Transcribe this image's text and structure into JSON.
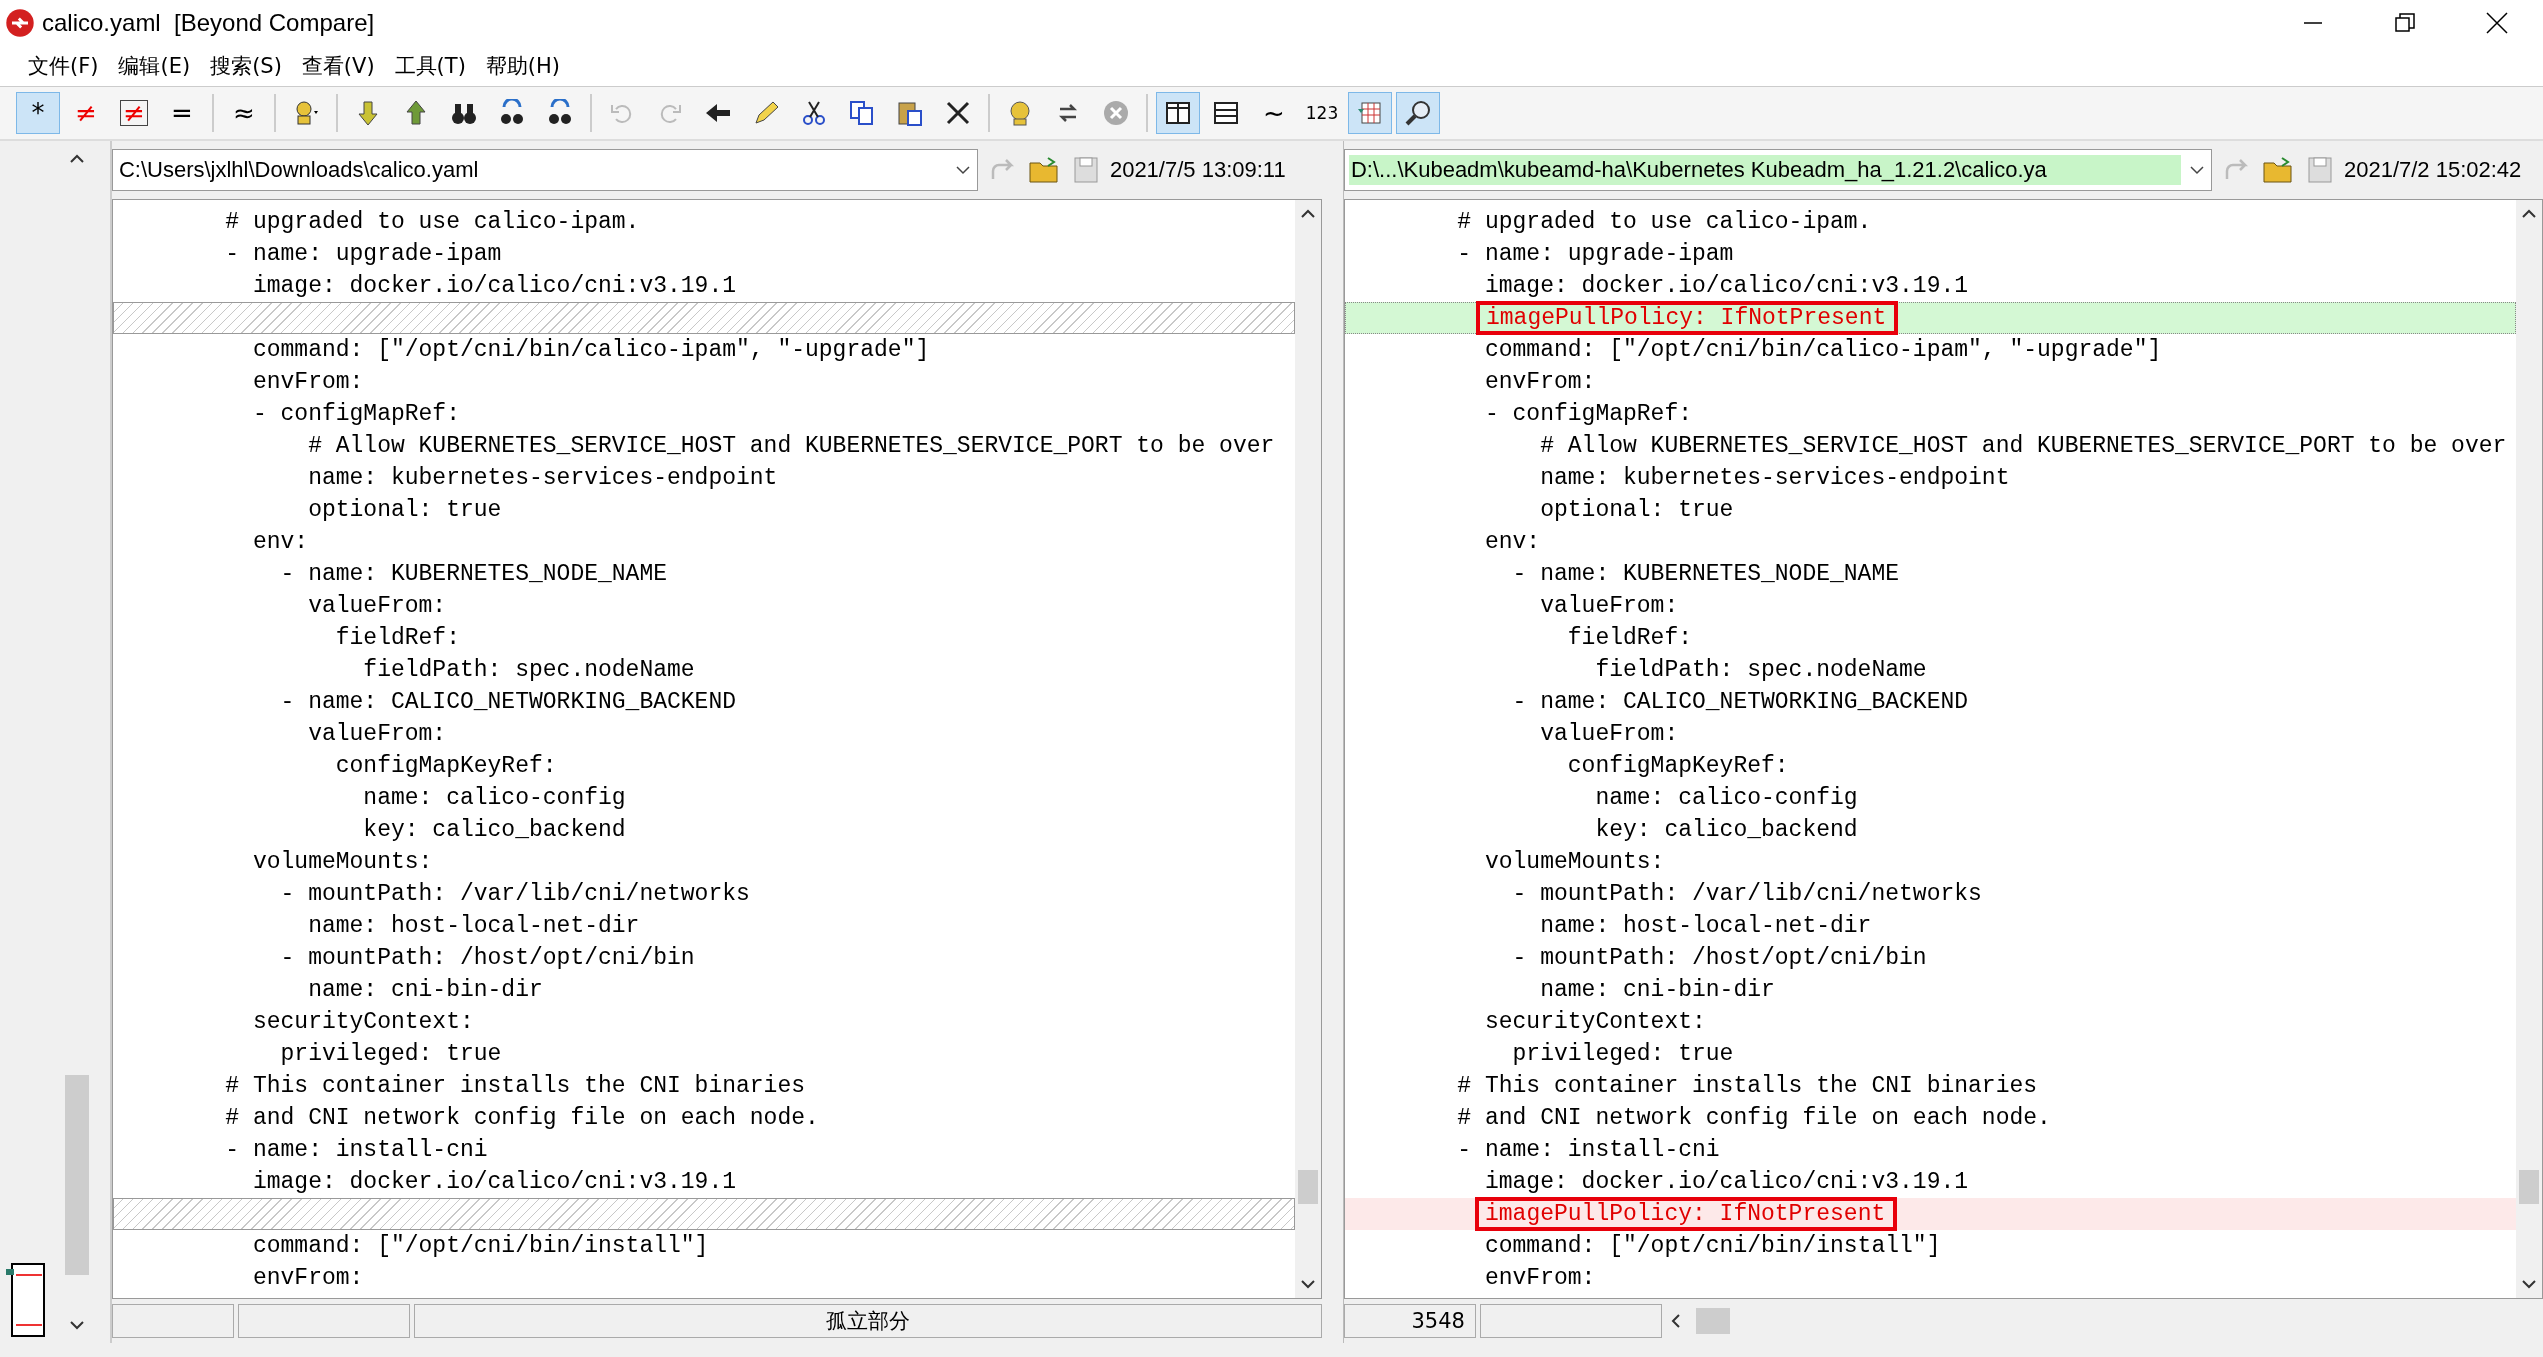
{
  "window": {
    "title": "calico.yaml  [Beyond Compare]"
  },
  "menu": [
    "文件(F)",
    "编辑(E)",
    "搜索(S)",
    "查看(V)",
    "工具(T)",
    "帮助(H)"
  ],
  "toolbar": [
    {
      "kind": "text",
      "label": "*",
      "selected": true
    },
    {
      "kind": "text",
      "label": "≠",
      "selected": false
    },
    {
      "kind": "boxed",
      "label": "≠",
      "selected": false
    },
    {
      "kind": "text",
      "label": "=",
      "selected": false
    },
    {
      "kind": "sep"
    },
    {
      "kind": "text",
      "label": "≈",
      "selected": false
    },
    {
      "kind": "sep"
    },
    {
      "kind": "icon",
      "selected": false
    },
    {
      "kind": "sep"
    },
    {
      "kind": "icon",
      "selected": false
    },
    {
      "kind": "icon",
      "selected": false
    },
    {
      "kind": "icon",
      "selected": false
    },
    {
      "kind": "icon",
      "selected": false
    },
    {
      "kind": "icon",
      "selected": false
    },
    {
      "kind": "sep"
    },
    {
      "kind": "icon",
      "selected": false
    },
    {
      "kind": "icon",
      "selected": false
    },
    {
      "kind": "icon",
      "selected": false
    },
    {
      "kind": "icon",
      "selected": false
    },
    {
      "kind": "icon",
      "selected": false
    },
    {
      "kind": "icon",
      "selected": false
    },
    {
      "kind": "icon",
      "selected": false
    },
    {
      "kind": "icon",
      "selected": false
    },
    {
      "kind": "sep"
    },
    {
      "kind": "icon",
      "selected": false
    },
    {
      "kind": "icon",
      "selected": false
    },
    {
      "kind": "icon",
      "selected": false
    },
    {
      "kind": "sep"
    },
    {
      "kind": "icon",
      "selected": true
    },
    {
      "kind": "icon",
      "selected": false
    },
    {
      "kind": "text",
      "label": "~",
      "selected": false
    },
    {
      "kind": "small",
      "label": "123",
      "selected": false
    },
    {
      "kind": "icon",
      "selected": true
    },
    {
      "kind": "icon",
      "selected": true
    }
  ],
  "panes": [
    {
      "path": "C:\\Users\\jxlhl\\Downloads\\calico.yaml",
      "path_differs": false,
      "date": "2021/7/5 13:09:11",
      "lines": [
        {
          "kind": "plain",
          "text": "        # upgraded to use calico-ipam."
        },
        {
          "kind": "plain",
          "text": "        - name: upgrade-ipam"
        },
        {
          "kind": "plain",
          "text": "          image: docker.io/calico/cni:v3.19.1"
        },
        {
          "kind": "gap"
        },
        {
          "kind": "plain",
          "text": "          command: [\"/opt/cni/bin/calico-ipam\", \"-upgrade\"]"
        },
        {
          "kind": "plain",
          "text": "          envFrom:"
        },
        {
          "kind": "plain",
          "text": "          - configMapRef:"
        },
        {
          "kind": "plain",
          "text": "              # Allow KUBERNETES_SERVICE_HOST and KUBERNETES_SERVICE_PORT to be over"
        },
        {
          "kind": "plain",
          "text": "              name: kubernetes-services-endpoint"
        },
        {
          "kind": "plain",
          "text": "              optional: true"
        },
        {
          "kind": "plain",
          "text": "          env:"
        },
        {
          "kind": "plain",
          "text": "            - name: KUBERNETES_NODE_NAME"
        },
        {
          "kind": "plain",
          "text": "              valueFrom:"
        },
        {
          "kind": "plain",
          "text": "                fieldRef:"
        },
        {
          "kind": "plain",
          "text": "                  fieldPath: spec.nodeName"
        },
        {
          "kind": "plain",
          "text": "            - name: CALICO_NETWORKING_BACKEND"
        },
        {
          "kind": "plain",
          "text": "              valueFrom:"
        },
        {
          "kind": "plain",
          "text": "                configMapKeyRef:"
        },
        {
          "kind": "plain",
          "text": "                  name: calico-config"
        },
        {
          "kind": "plain",
          "text": "                  key: calico_backend"
        },
        {
          "kind": "plain",
          "text": "          volumeMounts:"
        },
        {
          "kind": "plain",
          "text": "            - mountPath: /var/lib/cni/networks"
        },
        {
          "kind": "plain",
          "text": "              name: host-local-net-dir"
        },
        {
          "kind": "plain",
          "text": "            - mountPath: /host/opt/cni/bin"
        },
        {
          "kind": "plain",
          "text": "              name: cni-bin-dir"
        },
        {
          "kind": "plain",
          "text": "          securityContext:"
        },
        {
          "kind": "plain",
          "text": "            privileged: true"
        },
        {
          "kind": "plain",
          "text": "        # This container installs the CNI binaries"
        },
        {
          "kind": "plain",
          "text": "        # and CNI network config file on each node."
        },
        {
          "kind": "plain",
          "text": "        - name: install-cni"
        },
        {
          "kind": "plain",
          "text": "          image: docker.io/calico/cni:v3.19.1"
        },
        {
          "kind": "gap"
        },
        {
          "kind": "plain",
          "text": "          command: [\"/opt/cni/bin/install\"]"
        },
        {
          "kind": "plain",
          "text": "          envFrom:"
        }
      ],
      "status": {
        "section": "孤立部分"
      }
    },
    {
      "path": "D:\\...\\Kubeadm\\kubeamd-ha\\Kubernetes Kubeadm_ha_1.21.2\\calico.ya",
      "path_differs": true,
      "date": "2021/7/2 15:02:42",
      "lines": [
        {
          "kind": "plain",
          "text": "        # upgraded to use calico-ipam."
        },
        {
          "kind": "plain",
          "text": "        - name: upgrade-ipam"
        },
        {
          "kind": "plain",
          "text": "          image: docker.io/calico/cni:v3.19.1"
        },
        {
          "kind": "added",
          "text": "          imagePullPolicy: IfNotPresent",
          "boxed": true
        },
        {
          "kind": "plain",
          "text": "          command: [\"/opt/cni/bin/calico-ipam\", \"-upgrade\"]"
        },
        {
          "kind": "plain",
          "text": "          envFrom:"
        },
        {
          "kind": "plain",
          "text": "          - configMapRef:"
        },
        {
          "kind": "plain",
          "text": "              # Allow KUBERNETES_SERVICE_HOST and KUBERNETES_SERVICE_PORT to be over"
        },
        {
          "kind": "plain",
          "text": "              name: kubernetes-services-endpoint"
        },
        {
          "kind": "plain",
          "text": "              optional: true"
        },
        {
          "kind": "plain",
          "text": "          env:"
        },
        {
          "kind": "plain",
          "text": "            - name: KUBERNETES_NODE_NAME"
        },
        {
          "kind": "plain",
          "text": "              valueFrom:"
        },
        {
          "kind": "plain",
          "text": "                fieldRef:"
        },
        {
          "kind": "plain",
          "text": "                  fieldPath: spec.nodeName"
        },
        {
          "kind": "plain",
          "text": "            - name: CALICO_NETWORKING_BACKEND"
        },
        {
          "kind": "plain",
          "text": "              valueFrom:"
        },
        {
          "kind": "plain",
          "text": "                configMapKeyRef:"
        },
        {
          "kind": "plain",
          "text": "                  name: calico-config"
        },
        {
          "kind": "plain",
          "text": "                  key: calico_backend"
        },
        {
          "kind": "plain",
          "text": "          volumeMounts:"
        },
        {
          "kind": "plain",
          "text": "            - mountPath: /var/lib/cni/networks"
        },
        {
          "kind": "plain",
          "text": "              name: host-local-net-dir"
        },
        {
          "kind": "plain",
          "text": "            - mountPath: /host/opt/cni/bin"
        },
        {
          "kind": "plain",
          "text": "              name: cni-bin-dir"
        },
        {
          "kind": "plain",
          "text": "          securityContext:"
        },
        {
          "kind": "plain",
          "text": "            privileged: true"
        },
        {
          "kind": "plain",
          "text": "        # This container installs the CNI binaries"
        },
        {
          "kind": "plain",
          "text": "        # and CNI network config file on each node."
        },
        {
          "kind": "plain",
          "text": "        - name: install-cni"
        },
        {
          "kind": "plain",
          "text": "          image: docker.io/calico/cni:v3.19.1"
        },
        {
          "kind": "changed",
          "text": "          imagePullPolicy: IfNotPresent",
          "boxed": true
        },
        {
          "kind": "plain",
          "text": "          command: [\"/opt/cni/bin/install\"]"
        },
        {
          "kind": "plain",
          "text": "          envFrom:"
        }
      ],
      "status": {
        "count": "3548"
      }
    }
  ]
}
